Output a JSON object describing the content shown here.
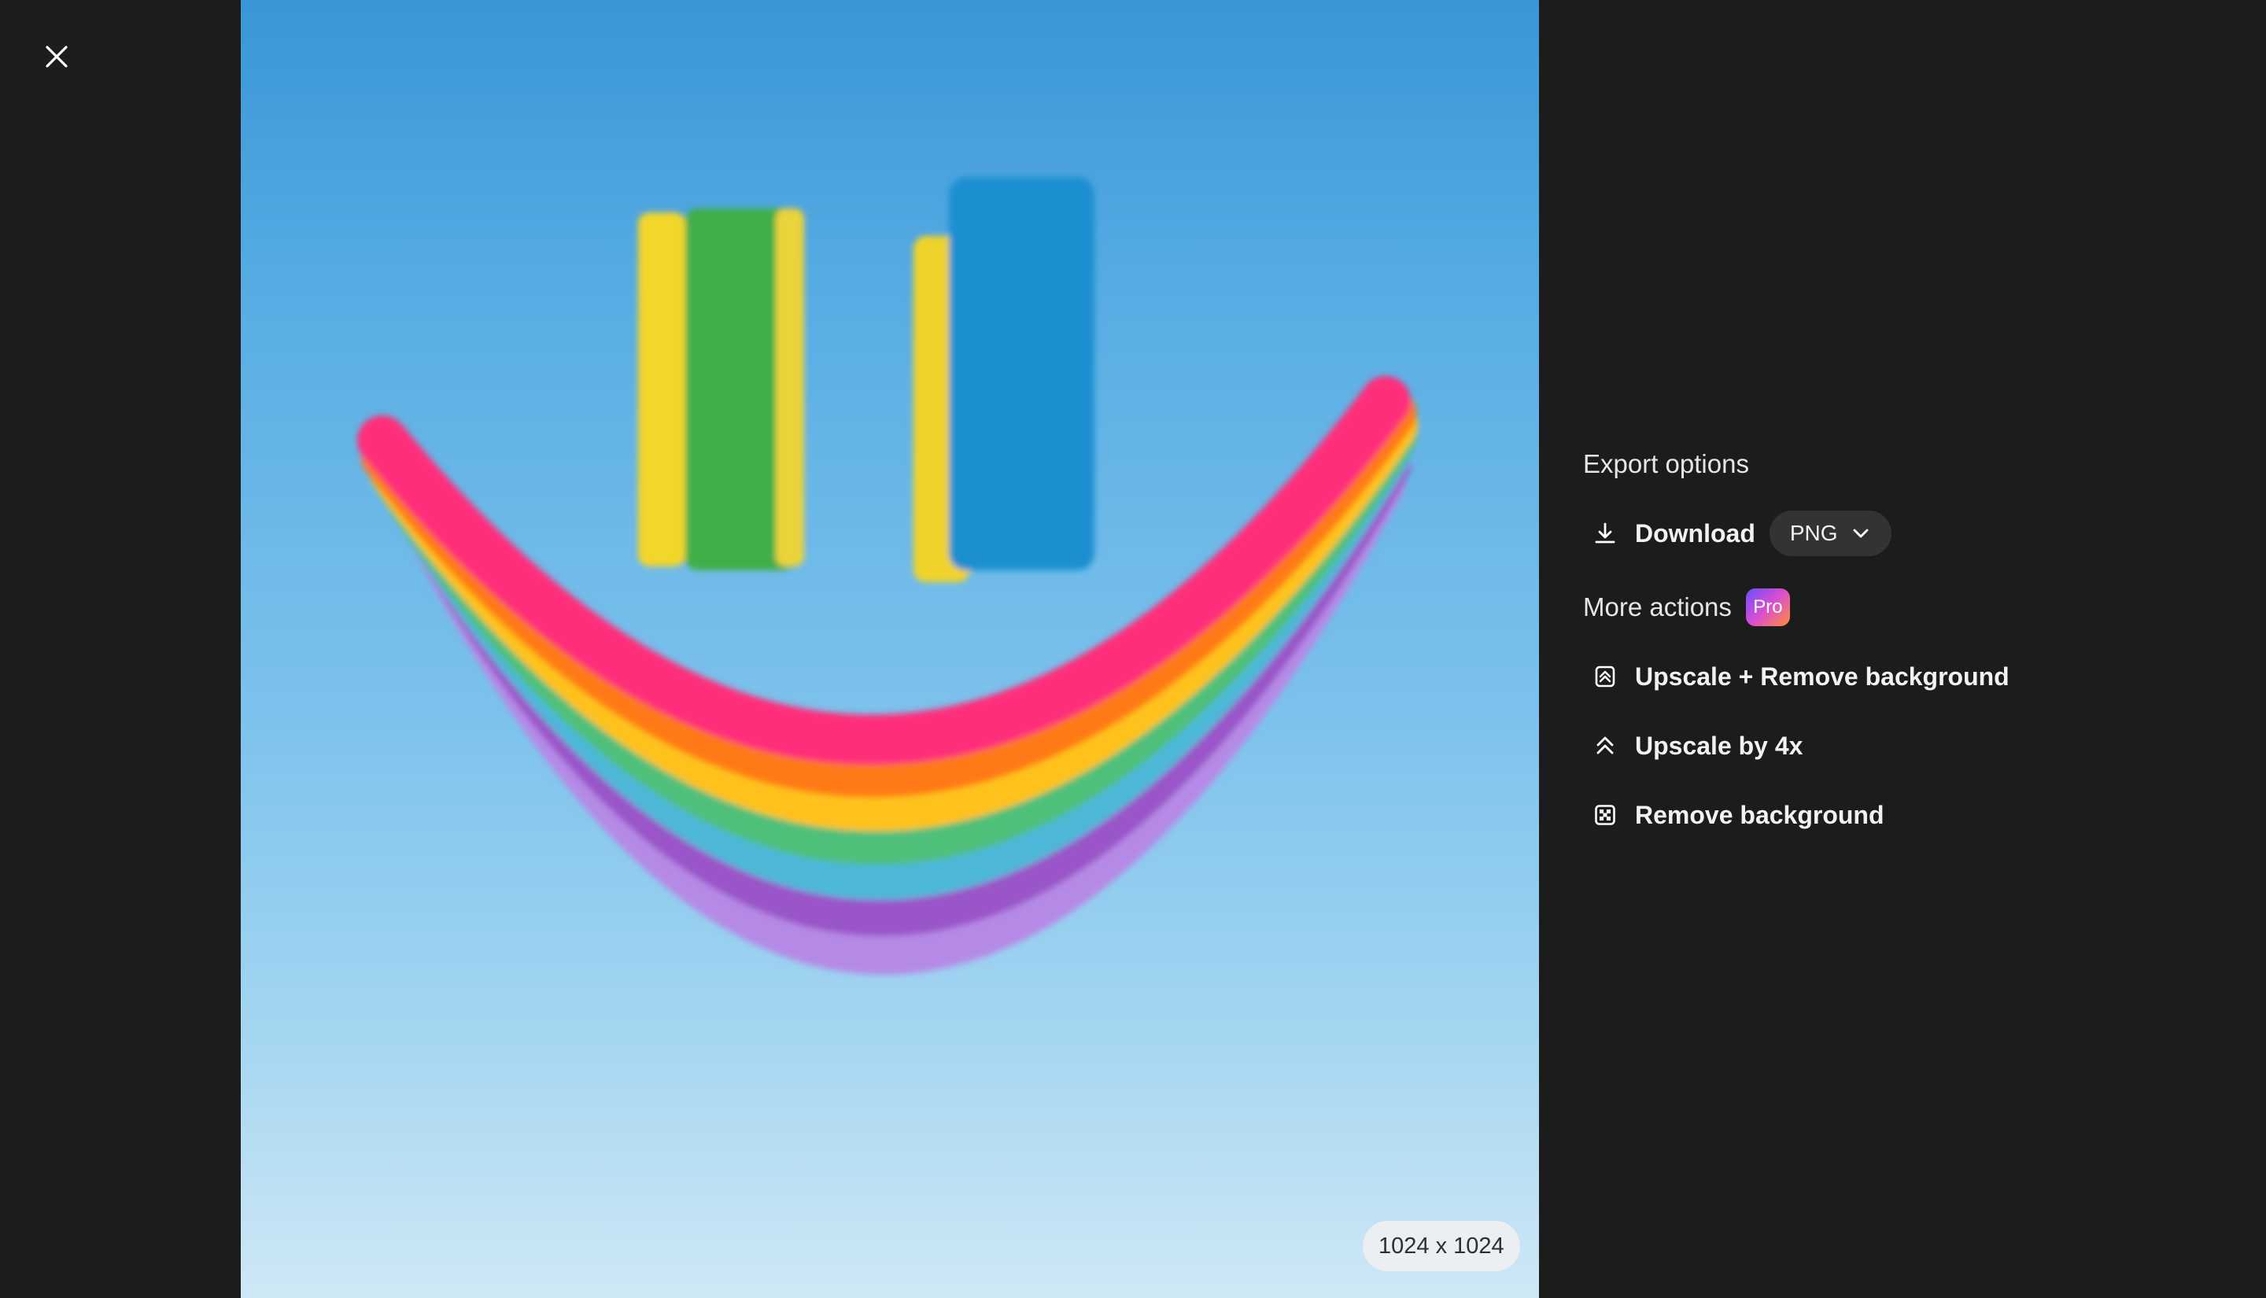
{
  "image": {
    "dimensions_label": "1024 x 1024"
  },
  "panel": {
    "export_title": "Export options",
    "download_label": "Download",
    "format_value": "PNG",
    "more_actions_title": "More actions",
    "pro_badge": "Pro",
    "actions": [
      {
        "label": "Upscale + Remove background",
        "icon": "upscale-remove-bg-icon"
      },
      {
        "label": "Upscale by 4x",
        "icon": "upscale-icon"
      },
      {
        "label": "Remove background",
        "icon": "remove-background-icon"
      }
    ]
  },
  "colors": {
    "background": "#1c1c1c",
    "select_bg": "#333333",
    "text": "#f2f2f2"
  }
}
